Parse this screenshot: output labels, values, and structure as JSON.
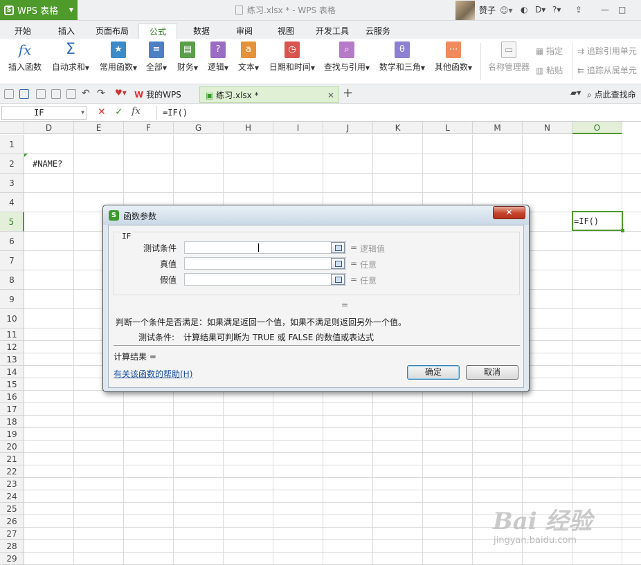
{
  "app": {
    "name": "WPS 表格",
    "doc_title": "练习.xlsx * - WPS 表格",
    "user": "赞子"
  },
  "window_controls": {
    "help": "?",
    "min": "—",
    "max": "□"
  },
  "tabs": [
    "开始",
    "插入",
    "页面布局",
    "公式",
    "数据",
    "审阅",
    "视图",
    "开发工具",
    "云服务"
  ],
  "active_tab": "公式",
  "ribbon": {
    "insert_fn": "插入函数",
    "autosum": "自动求和",
    "common": "常用函数",
    "all": "全部",
    "finance": "财务",
    "logic": "逻辑",
    "text": "文本",
    "datetime": "日期和时间",
    "lookup": "查找与引用",
    "math": "数学和三角",
    "other": "其他函数",
    "name_mgr": "名称管理器",
    "define": "指定",
    "paste": "粘贴",
    "trace_prec": "追踪引用单元",
    "trace_dep": "追踪从属单元"
  },
  "doc_tabs": {
    "mywps": "我的WPS",
    "file": "练习.xlsx *",
    "search": "点此查找命"
  },
  "formula_bar": {
    "name_box": "IF",
    "fx": "fx",
    "formula": "=IF()"
  },
  "columns": [
    "D",
    "E",
    "F",
    "G",
    "H",
    "I",
    "J",
    "K",
    "L",
    "M",
    "N",
    "O"
  ],
  "rows": [
    "1",
    "2",
    "3",
    "4",
    "5",
    "6",
    "7",
    "8",
    "9",
    "10",
    "11",
    "12",
    "13",
    "14",
    "15",
    "16",
    "17",
    "18",
    "19",
    "20",
    "21",
    "22",
    "23",
    "24",
    "25",
    "26",
    "27",
    "28",
    "29"
  ],
  "cells": {
    "D2": "#NAME?",
    "O5": "=IF()"
  },
  "dialog": {
    "title": "函数参数",
    "function": "IF",
    "args": [
      {
        "label": "测试条件",
        "value": "",
        "result": "逻辑值"
      },
      {
        "label": "真值",
        "value": "",
        "result": "任意"
      },
      {
        "label": "假值",
        "value": "",
        "result": "任意"
      }
    ],
    "eq": "=",
    "description": "判断一个条件是否满足：如果满足返回一个值，如果不满足则返回另外一个值。",
    "arg_help_label": "测试条件:",
    "arg_help": "计算结果可判断为 TRUE 或 FALSE 的数值或表达式",
    "calc_result_label": "计算结果 =",
    "help_link": "有关该函数的帮助(H)",
    "ok": "确定",
    "cancel": "取消"
  },
  "watermark": {
    "brand": "Bai 经验",
    "url": "jingyan.baidu.com"
  }
}
